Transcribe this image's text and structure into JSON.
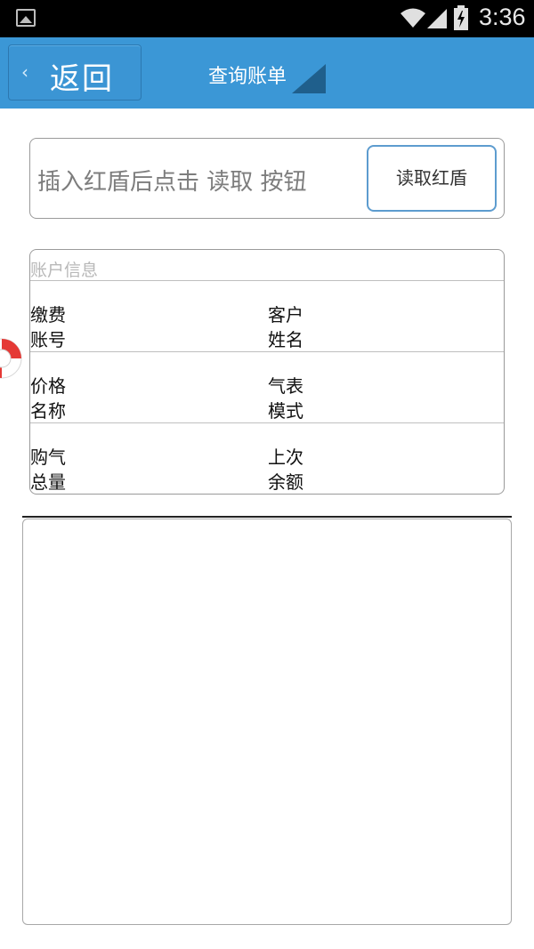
{
  "status_bar": {
    "time": "3:36"
  },
  "header": {
    "back_label": "返回",
    "title": "查询账单"
  },
  "read_card": {
    "hint": "插入红盾后点击 读取 按钮",
    "button_label": "读取红盾"
  },
  "account": {
    "title": "账户信息",
    "rows": [
      {
        "left": [
          "缴费",
          "账号"
        ],
        "right": [
          "客户",
          "姓名"
        ]
      },
      {
        "left": [
          "价格",
          "名称"
        ],
        "right": [
          "气表",
          "模式"
        ]
      },
      {
        "left": [
          "购气",
          "总量"
        ],
        "right": [
          "上次",
          "余额"
        ]
      }
    ]
  },
  "colors": {
    "appbar": "#3b97d6",
    "status_bar": "#000000",
    "button_border": "#5d9ccf"
  }
}
